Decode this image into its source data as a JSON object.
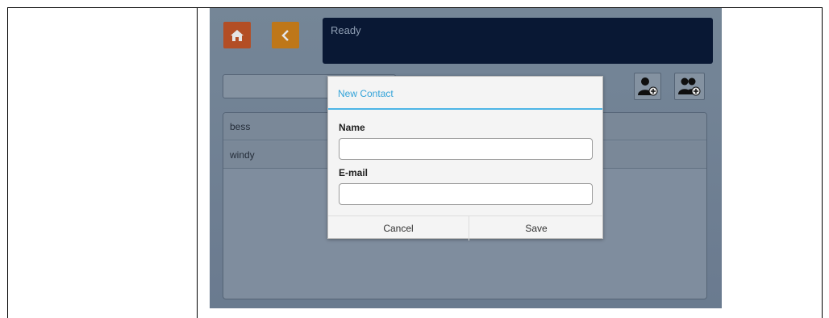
{
  "status": {
    "text": "Ready"
  },
  "icons": {
    "home": "home-icon",
    "back": "chevron-left-icon",
    "add_contact": "add-contact-icon",
    "add_group": "add-group-icon"
  },
  "contacts": [
    {
      "name": "bess"
    },
    {
      "name": "windy"
    }
  ],
  "dialog": {
    "title": "New Contact",
    "name_label": "Name",
    "name_value": "",
    "email_label": "E-mail",
    "email_value": "",
    "cancel_label": "Cancel",
    "save_label": "Save"
  },
  "colors": {
    "home_button": "#c8572a",
    "back_button": "#d4851c",
    "status_bg": "#0b1b3a",
    "dialog_accent": "#33a3d9"
  }
}
